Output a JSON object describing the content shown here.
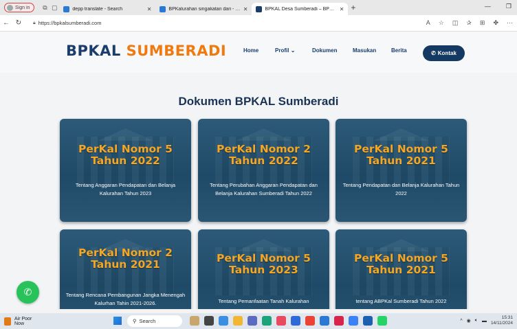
{
  "browser": {
    "signin_label": "Sign in",
    "tabs": [
      {
        "label": "depp translate - Search",
        "active": false
      },
      {
        "label": "BPKalurahan singakatan dari - Sea",
        "active": false
      },
      {
        "label": "BPKAL Desa Sumberadi – BPKAL",
        "active": true
      }
    ],
    "url": "https://bpkalsumberadi.com"
  },
  "site": {
    "logo_part1": "BPKAL ",
    "logo_part2": "SUMBERADI",
    "nav": {
      "home": "Home",
      "profil": "Profil",
      "dokumen": "Dokumen",
      "masukan": "Masukan",
      "berita": "Berita",
      "kontak": "Kontak"
    },
    "page_title": "Dokumen BPKAL Sumberadi",
    "cards": [
      {
        "title_line1": "PerKal Nomor 5",
        "title_line2": "Tahun 2022",
        "desc": "Tentang Anggaran Pendapatan dan Belanja Kalurahan Tahun 2023"
      },
      {
        "title_line1": "PerKal Nomor 2",
        "title_line2": "Tahun 2022",
        "desc": "Tentang Perubahan Anggaran Pendapatan dan Belanja Kalurahan Sumberadi Tahun 2022"
      },
      {
        "title_line1": "PerKal Nomor 5",
        "title_line2": "Tahun 2021",
        "desc": "Tentang Pendapatan dan Belanja Kalurahan Tahun 2022"
      },
      {
        "title_line1": "PerKal Nomor 2",
        "title_line2": "Tahun 2021",
        "desc": "Tentang Rencana Pembangunan Jangka Menengah Kalurhan Tahin 2021-2026."
      },
      {
        "title_line1": "PerKal Nomor 5",
        "title_line2": "Tahun 2023",
        "desc": "Tentang Pemanfaatan Tanah Kalurahan"
      },
      {
        "title_line1": "PerKal Nomor 5",
        "title_line2": "Tahun 2021",
        "desc": "tentang ABPKal Sumberadi Tahun 2022"
      }
    ]
  },
  "taskbar": {
    "weather_line1": "Air Poor",
    "weather_line2": "Now",
    "search_label": "Search",
    "time": "15:31",
    "date": "14/11/2024"
  },
  "colors": {
    "brand_navy": "#1a3d6b",
    "brand_orange": "#f07a10",
    "card_title": "#f5a623",
    "whatsapp": "#27c35a"
  }
}
